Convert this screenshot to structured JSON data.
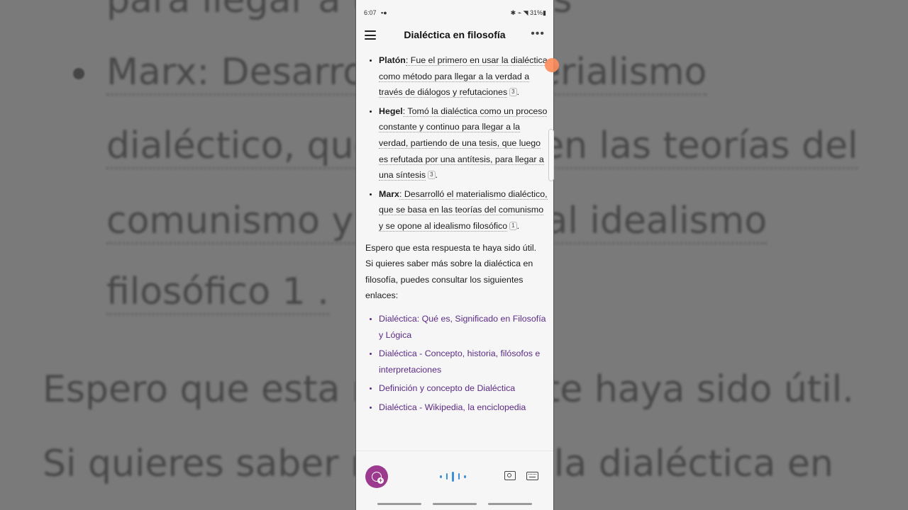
{
  "background": {
    "lines": [
      "para llegar a una síntesis",
      "Marx: Desarrolló el materialismo",
      "dialéctico, que se basa en las teorías del",
      "comunismo y se opone al idealismo",
      "filosófico 1 .",
      "Espero que esta respuesta te haya sido útil.",
      "Si quieres saber más sobre la dialéctica en"
    ]
  },
  "status_bar": {
    "time": "6:07",
    "battery": "31%"
  },
  "app_bar": {
    "title": "Dialéctica en filosofía"
  },
  "content": {
    "bullets": [
      {
        "term": "Platón",
        "text": ": Fue el primero en usar la dialéctica como método para llegar a la verdad a través de diálogos y refutaciones",
        "ref": "3",
        "end": "."
      },
      {
        "term": "Hegel",
        "text": ": Tomó la dialéctica como un proceso constante y continuo para llegar a la verdad, partiendo de una tesis, que luego es refutada por una antítesis, para llegar a una síntesis",
        "ref": "3",
        "end": "."
      },
      {
        "term": "Marx",
        "text": ": Desarrolló el materialismo dialéctico, que se basa en las teorías del comunismo y se opone al idealismo filosófico",
        "ref": "1",
        "end": "."
      }
    ],
    "closing": "Espero que esta respuesta te haya sido útil. Si quieres saber más sobre la dialéctica en filosofía, puedes consultar los siguientes enlaces:",
    "links": [
      "Dialéctica: Qué es, Significado en Filosofía y Lógica",
      "Dialéctica - Concepto, historia, filósofos e interpretaciones",
      "Definición y concepto de Dialéctica",
      "Dialéctica - Wikipedia, la enciclopedia"
    ]
  },
  "colors": {
    "accent": "#9c3a8f",
    "link": "#5b2a86",
    "voice": "#3d8fd6"
  }
}
